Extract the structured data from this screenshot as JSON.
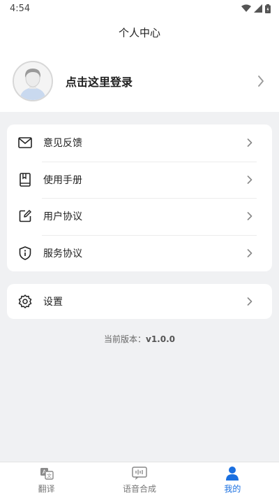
{
  "status_bar": {
    "time": "4:54"
  },
  "header": {
    "title": "个人中心"
  },
  "profile": {
    "login_text": "点击这里登录"
  },
  "menu": [
    {
      "label": "意见反馈",
      "icon": "mail-icon"
    },
    {
      "label": "使用手册",
      "icon": "book-icon"
    },
    {
      "label": "用户协议",
      "icon": "edit-icon"
    },
    {
      "label": "服务协议",
      "icon": "info-shield-icon"
    }
  ],
  "settings": {
    "label": "设置",
    "icon": "gear-icon"
  },
  "version": {
    "prefix": "当前版本：",
    "number": "v1.0.0"
  },
  "tabbar": {
    "items": [
      {
        "label": "翻译",
        "icon": "translate-icon"
      },
      {
        "label": "语音合成",
        "icon": "speech-synthesis-icon"
      },
      {
        "label": "我的",
        "icon": "user-icon"
      }
    ],
    "active_index": 2,
    "active_color": "#1a6fe0"
  }
}
